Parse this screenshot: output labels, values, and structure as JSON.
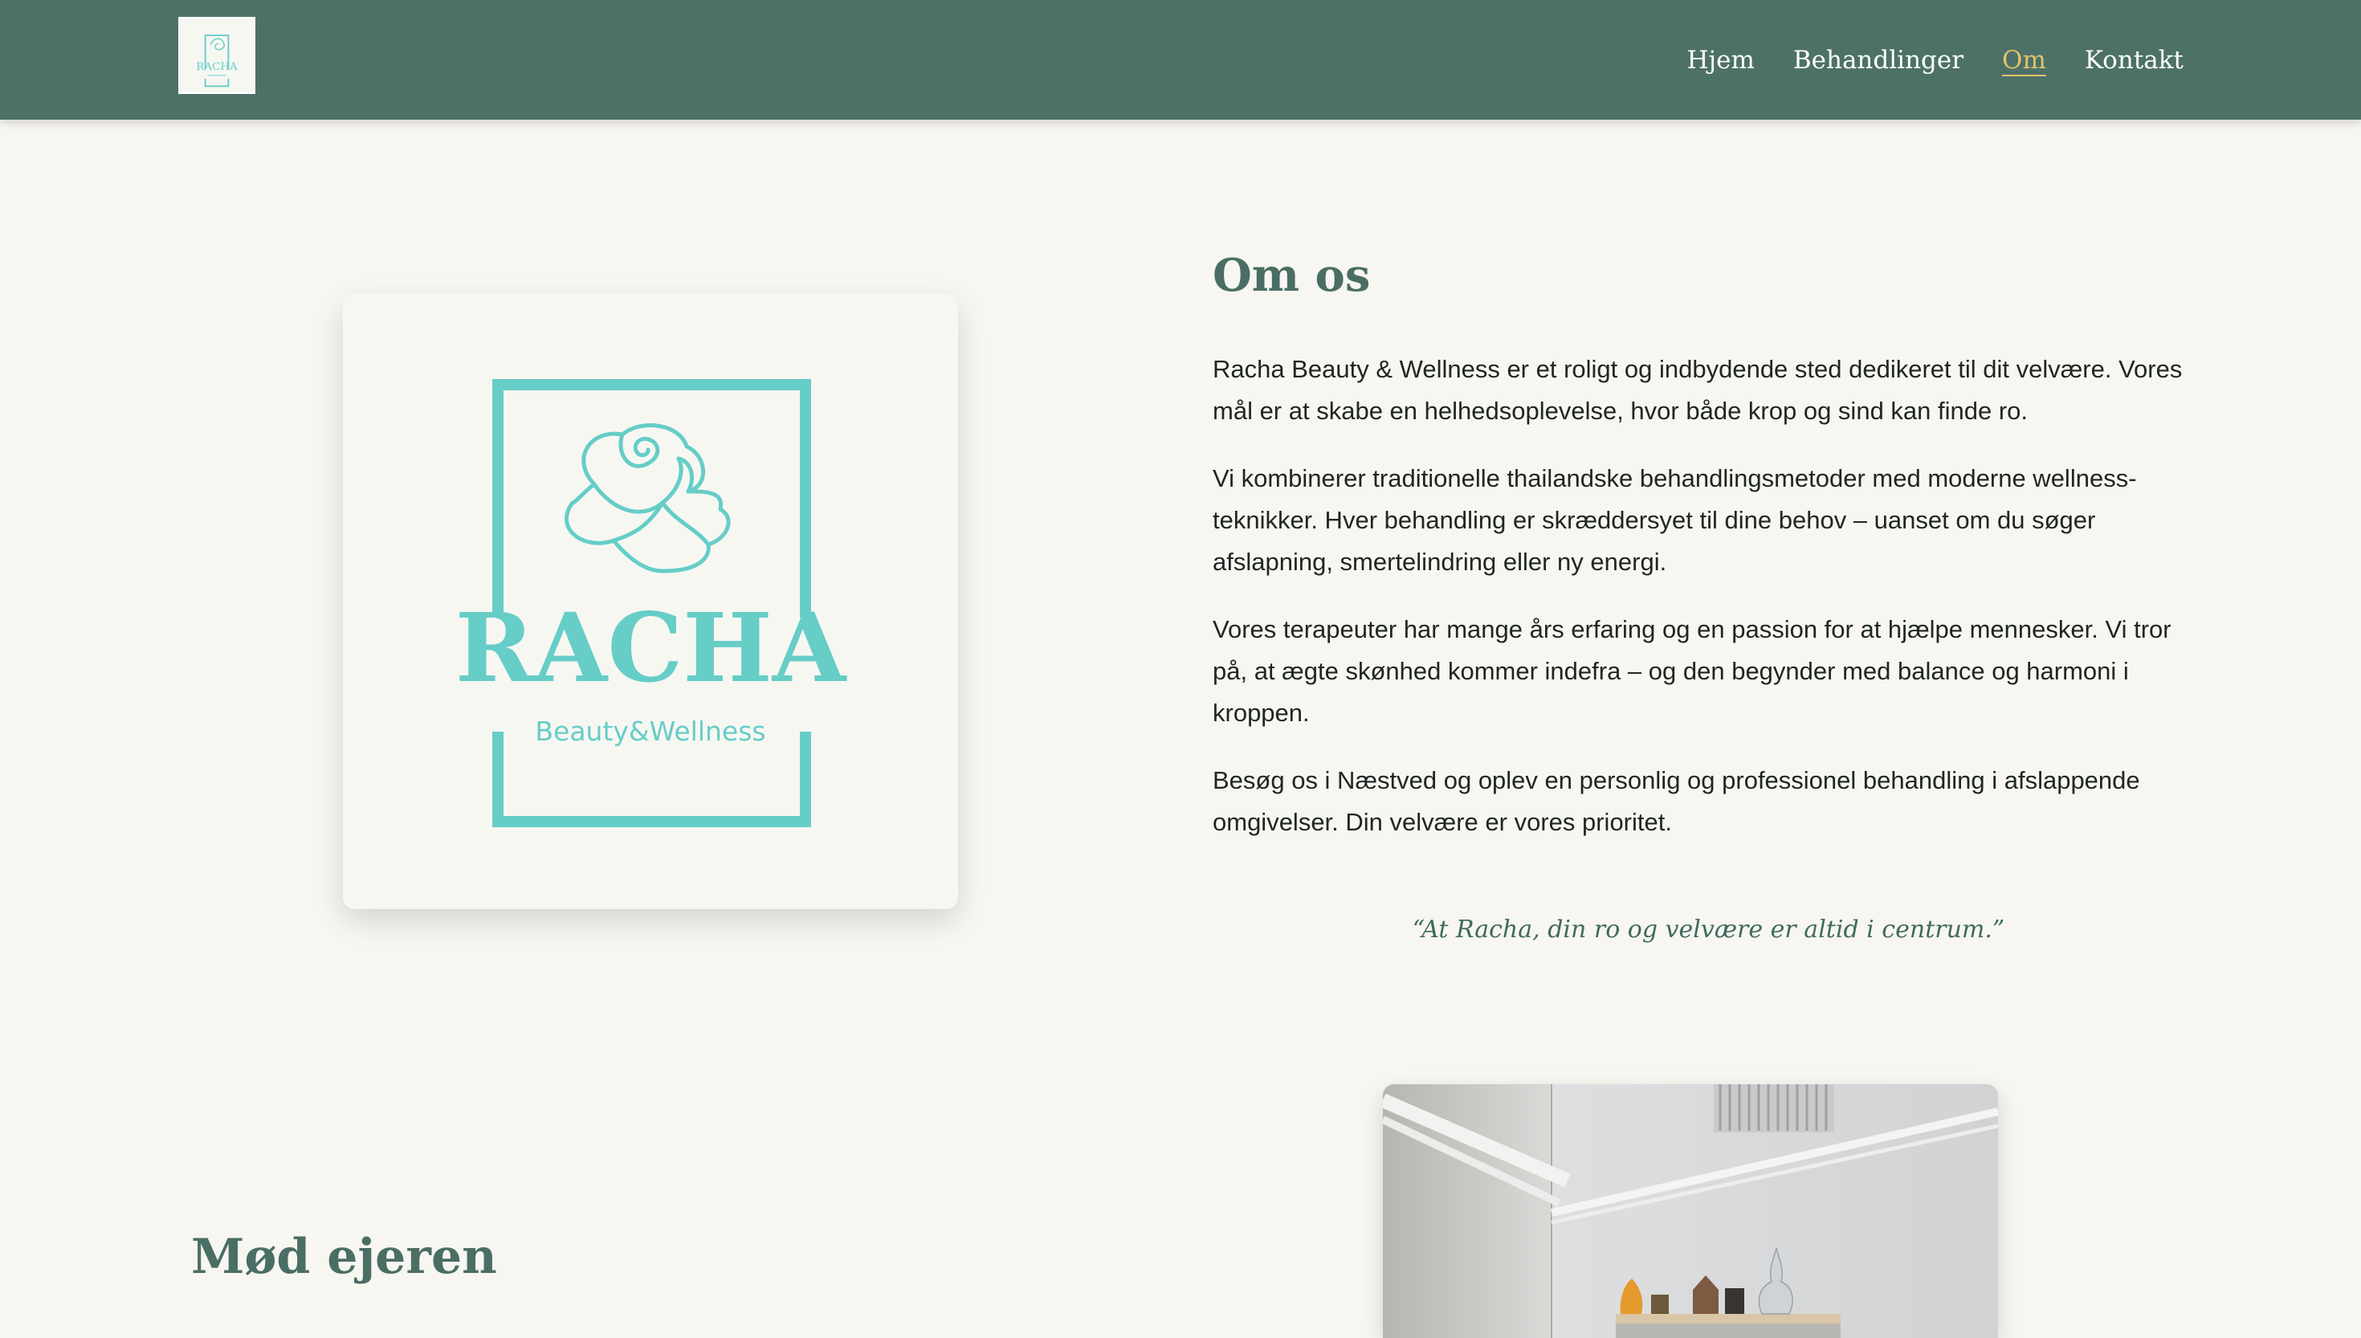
{
  "nav": {
    "logo_text": "RACHA",
    "links": [
      {
        "label": "Hjem",
        "active": false
      },
      {
        "label": "Behandlinger",
        "active": false
      },
      {
        "label": "Om",
        "active": true
      },
      {
        "label": "Kontakt",
        "active": false
      }
    ]
  },
  "brand_logo": {
    "name": "RACHA",
    "tagline": "Beauty&Wellness",
    "color": "#66cdc7"
  },
  "about": {
    "title": "Om os",
    "paragraphs": [
      [
        "Racha Beauty & Wellness er et roligt og indbydende sted dedikeret til dit velvære. Vores",
        "mål er at skabe en helhedsoplevelse, hvor både krop og sind kan finde ro."
      ],
      [
        "Vi kombinerer traditionelle thailandske behandlingsmetoder med moderne wellness-",
        "teknikker. Hver behandling er skræddersyet til dine behov – uanset om du søger",
        "afslapning, smertelindring eller ny energi."
      ],
      [
        "Vores terapeuter har mange års erfaring og en passion for at hjælpe mennesker. Vi tror",
        "på, at ægte skønhed kommer indefra – og den begynder med balance og harmoni i",
        "kroppen."
      ],
      [
        "Besøg os i Næstved og oplev en personlig og professionel behandling i afslappende",
        "omgivelser. Din velvære er vores prioritet."
      ]
    ],
    "quote": "“At Racha, din ro og velvære er altid i centrum.”"
  },
  "owner": {
    "title": "Mød ejeren"
  },
  "colors": {
    "nav_bg": "#4d7167",
    "active_link": "#e0c46a",
    "heading": "#4a6e63",
    "page_bg": "#f7f6f1",
    "logo_teal": "#66cdc7"
  }
}
